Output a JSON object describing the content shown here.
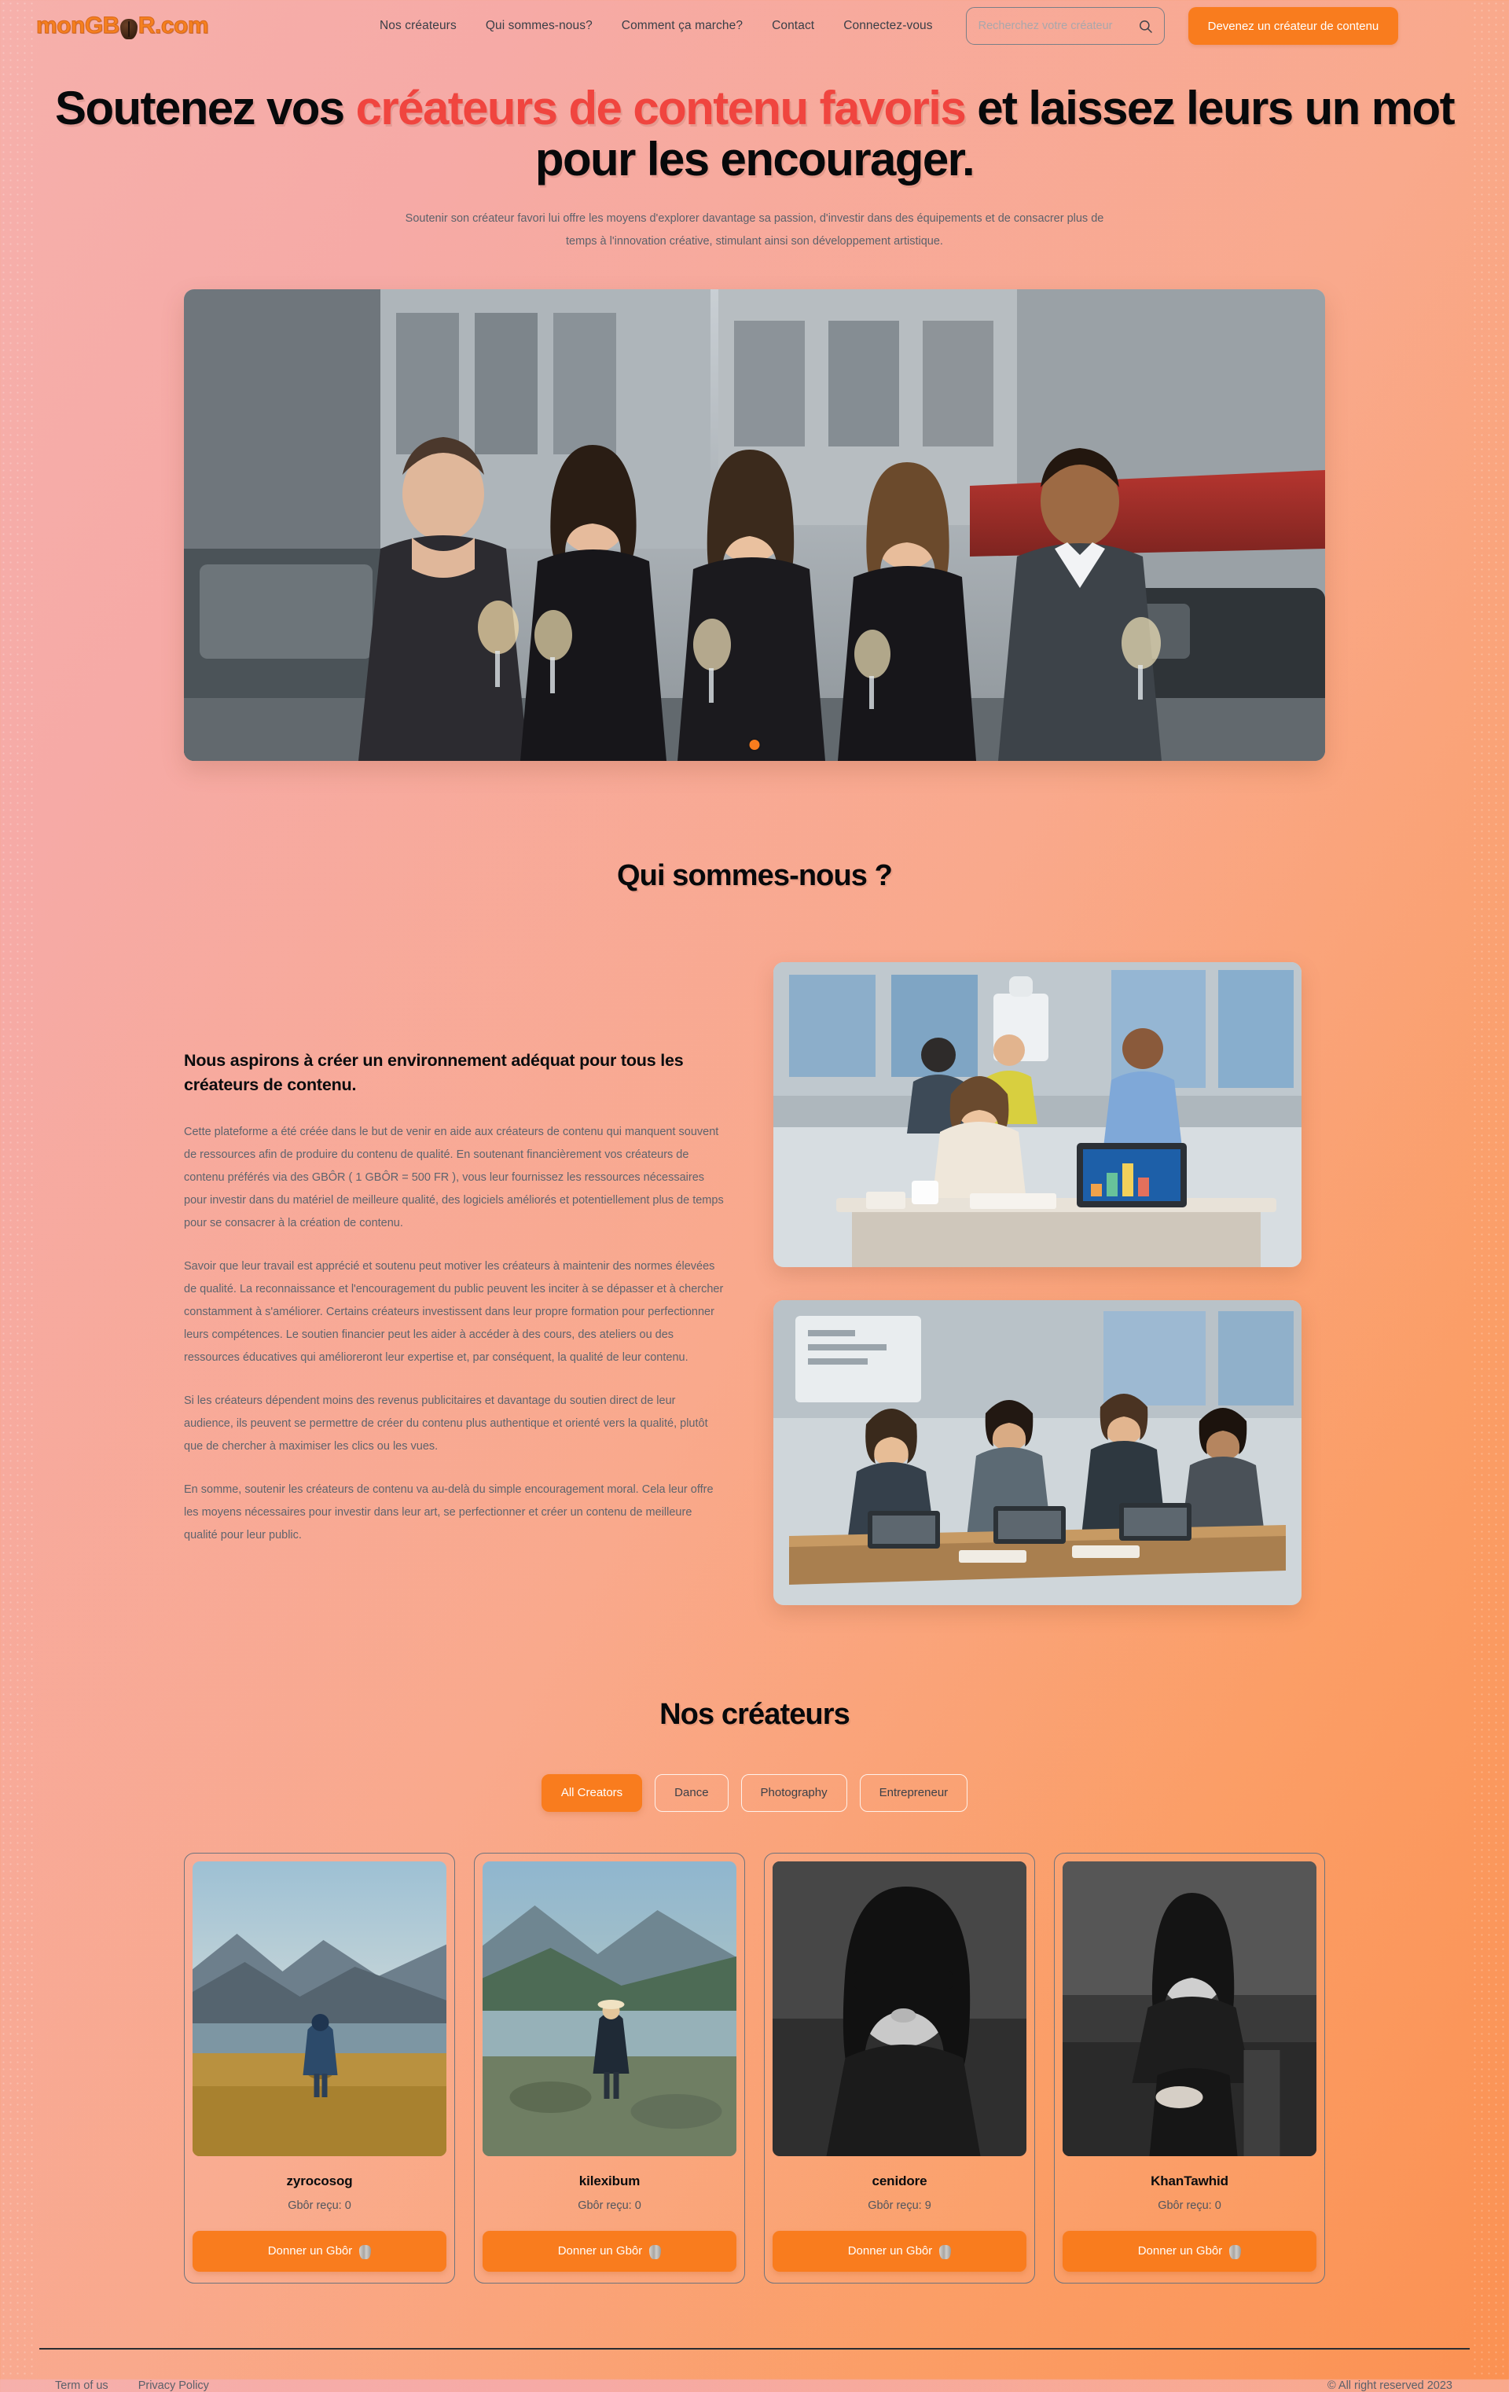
{
  "brand": {
    "logo_text_1": "monGB",
    "logo_text_2": "R.com"
  },
  "nav": {
    "links": [
      {
        "label": "Nos créateurs"
      },
      {
        "label": "Qui sommes-nous?"
      },
      {
        "label": "Comment ça marche?"
      },
      {
        "label": "Contact"
      },
      {
        "label": "Connectez-vous"
      }
    ],
    "search_placeholder": "Recherchez votre créateur",
    "search_value": "",
    "cta_label": "Devenez un créateur de contenu"
  },
  "hero": {
    "title_part1": "Soutenez vos ",
    "title_highlight1": "créateurs de contenu favoris",
    "title_part2": " et laissez leurs un mot pour les encourager.",
    "subtitle": "Soutenir son créateur favori lui offre les moyens d'explorer davantage sa passion, d'investir dans des équipements et de consacrer plus de temps à l'innovation créative, stimulant ainsi son développement artistique."
  },
  "about": {
    "heading": "Qui sommes-nous ?",
    "subheading": "Nous aspirons à créer un environnement adéquat pour tous les créateurs de contenu.",
    "paragraphs": [
      "Cette plateforme a été créée dans le but de venir en aide aux créateurs de contenu qui manquent souvent de ressources afin de produire du contenu de qualité. En soutenant financièrement vos créateurs de contenu préférés via des GBÔR ( 1 GBÔR = 500 FR ), vous leur fournissez les ressources nécessaires pour investir dans du matériel de meilleure qualité, des logiciels améliorés et potentiellement plus de temps pour se consacrer à la création de contenu.",
      "Savoir que leur travail est apprécié et soutenu peut motiver les créateurs à maintenir des normes élevées de qualité. La reconnaissance et l'encouragement du public peuvent les inciter à se dépasser et à chercher constamment à s'améliorer. Certains créateurs investissent dans leur propre formation pour perfectionner leurs compétences. Le soutien financier peut les aider à accéder à des cours, des ateliers ou des ressources éducatives qui amélioreront leur expertise et, par conséquent, la qualité de leur contenu.",
      "Si les créateurs dépendent moins des revenus publicitaires et davantage du soutien direct de leur audience, ils peuvent se permettre de créer du contenu plus authentique et orienté vers la qualité, plutôt que de chercher à maximiser les clics ou les vues.",
      "En somme, soutenir les créateurs de contenu va au-delà du simple encouragement moral. Cela leur offre les moyens nécessaires pour investir dans leur art, se perfectionner et créer un contenu de meilleure qualité pour leur public."
    ]
  },
  "creators_section": {
    "heading": "Nos créateurs",
    "filters": [
      {
        "label": "All Creators",
        "active": true
      },
      {
        "label": "Dance",
        "active": false
      },
      {
        "label": "Photography",
        "active": false
      },
      {
        "label": "Entrepreneur",
        "active": false
      }
    ],
    "donate_label": "Donner un Gbôr",
    "creators": [
      {
        "name": "zyrocosog",
        "meta": "Gbôr reçu: 0"
      },
      {
        "name": "kilexibum",
        "meta": "Gbôr reçu: 0"
      },
      {
        "name": "cenidore",
        "meta": "Gbôr reçu: 9"
      },
      {
        "name": "KhanTawhid",
        "meta": "Gbôr reçu: 0"
      }
    ]
  },
  "footer": {
    "terms": "Term of us",
    "privacy": "Privacy Policy",
    "copyright": "© All right reserved 2023"
  },
  "colors": {
    "accent": "#f97c1e",
    "highlight": "#f0453f",
    "text": "#0a0c0e",
    "muted": "#5f646d"
  }
}
